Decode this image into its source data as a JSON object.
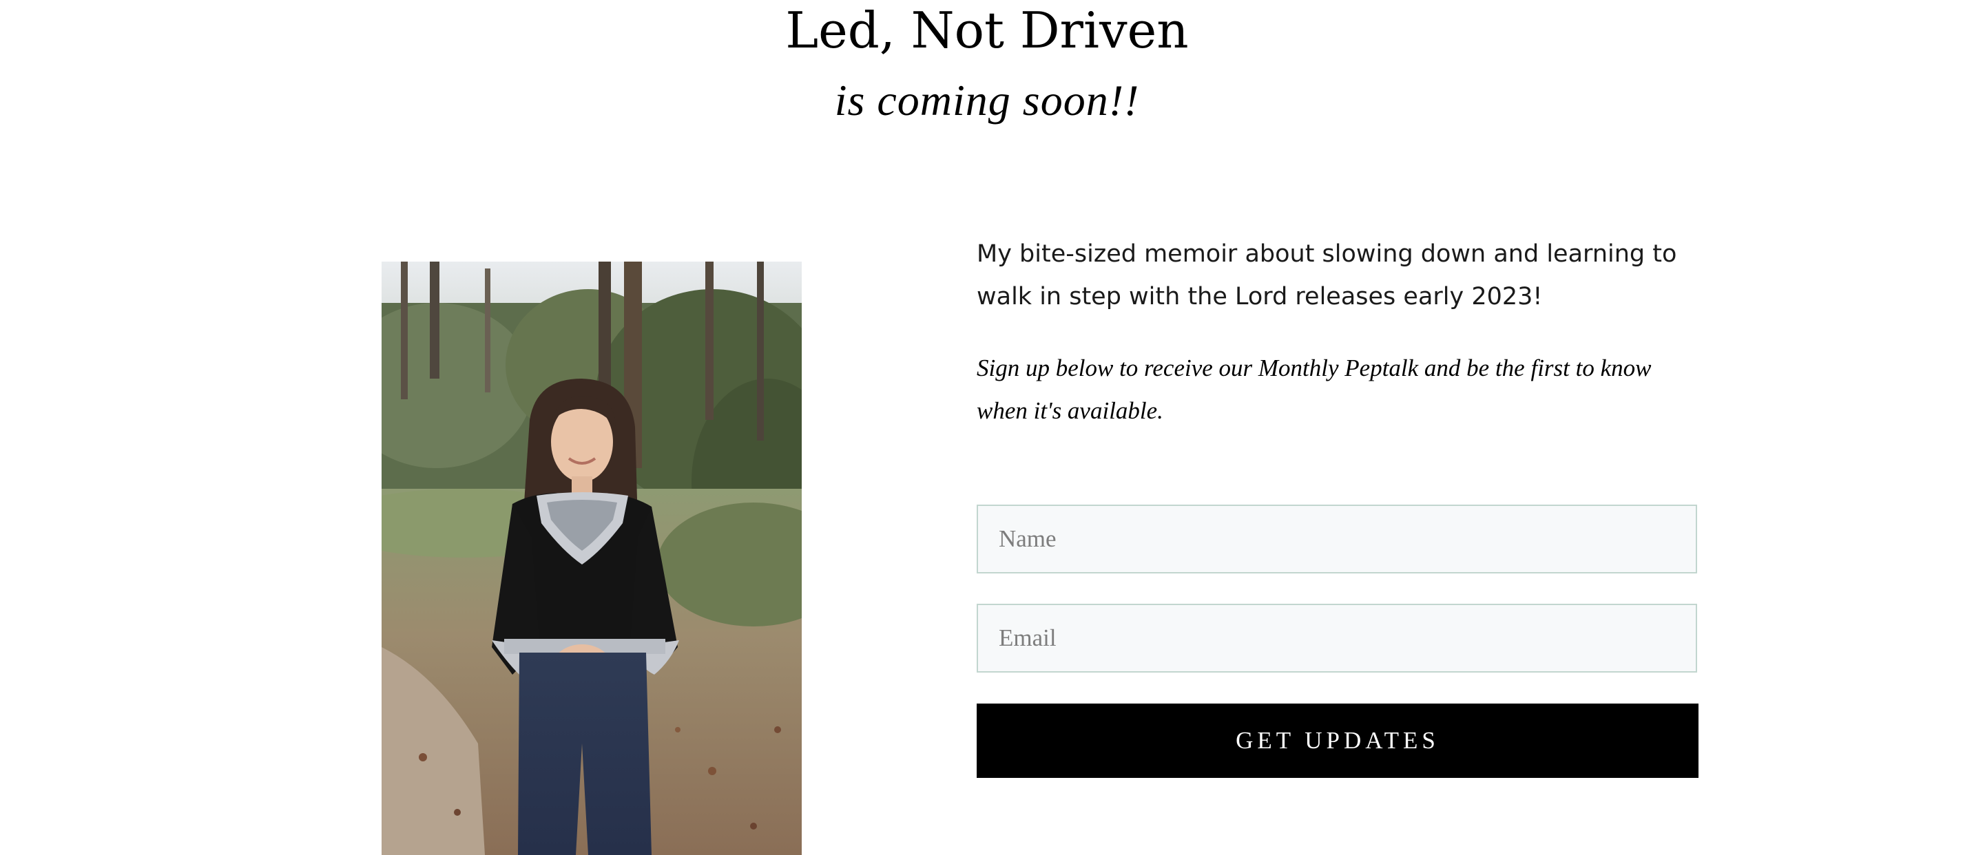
{
  "hero": {
    "title": "Led, Not Driven",
    "subtitle": "is coming soon!!"
  },
  "intro": {
    "description": "My bite-sized memoir about slowing down and learning to walk in step with the Lord releases early 2023!",
    "signup_text": "Sign up below to receive our Monthly Peptalk and be the first to know when it's available."
  },
  "form": {
    "name_placeholder": "Name",
    "email_placeholder": "Email",
    "submit_label": "GET UPDATES"
  },
  "colors": {
    "field_border": "#c2d6cf",
    "field_background": "#f7f9fa",
    "button_background": "#000000",
    "button_text": "#ffffff"
  }
}
